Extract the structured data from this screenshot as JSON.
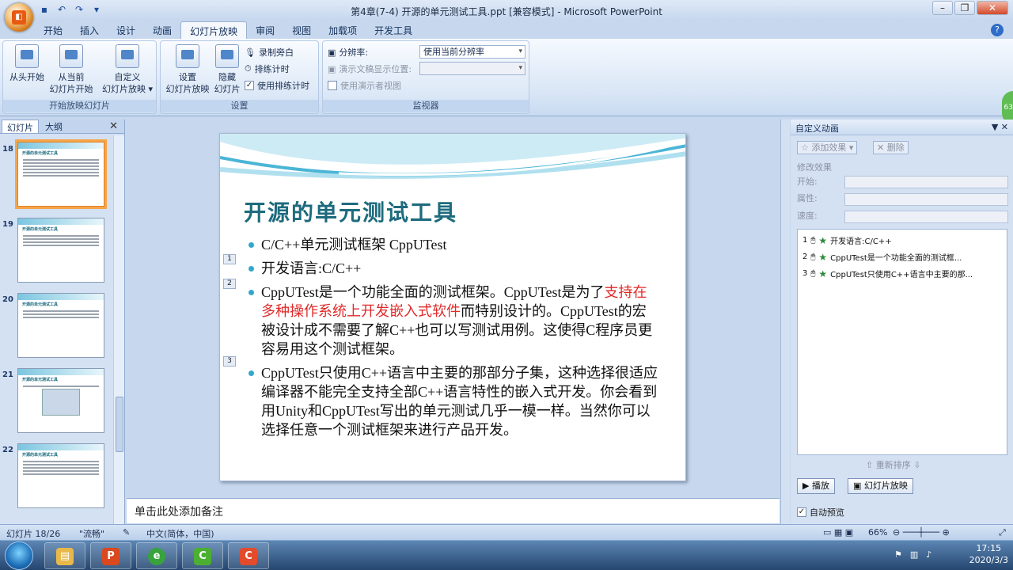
{
  "window": {
    "title": "第4章(7-4) 开源的单元测试工具.ppt [兼容模式] - Microsoft PowerPoint"
  },
  "ribbon_tabs": [
    "开始",
    "插入",
    "设计",
    "动画",
    "幻灯片放映",
    "审阅",
    "视图",
    "加载项",
    "开发工具"
  ],
  "ribbon": {
    "start_group": {
      "label": "开始放映幻灯片",
      "from_start": "从头开始",
      "from_current_1": "从当前",
      "from_current_2": "幻灯片开始",
      "custom_1": "自定义",
      "custom_2": "幻灯片放映"
    },
    "setup_group": {
      "label": "设置",
      "setup_1": "设置",
      "setup_2": "幻灯片放映",
      "hide_1": "隐藏",
      "hide_2": "幻灯片",
      "record": "录制旁白",
      "rehearse": "排练计时",
      "use_timing": "使用排练计时"
    },
    "monitor_group": {
      "label": "监视器",
      "resolution_label": "分辨率:",
      "resolution_value": "使用当前分辨率",
      "show_on_label": "演示文稿显示位置:",
      "presenter_view": "使用演示者视图"
    },
    "green_badge": "63"
  },
  "left_pane": {
    "tabs": [
      "幻灯片",
      "大纲"
    ],
    "slides": [
      {
        "num": "18",
        "title": "开源的单元测试工具"
      },
      {
        "num": "19",
        "title": "开源的单元测试工具"
      },
      {
        "num": "20",
        "title": "开源的单元测试工具"
      },
      {
        "num": "21",
        "title": "开源的单元测试工具"
      },
      {
        "num": "22",
        "title": "开源的单元测试工具"
      }
    ]
  },
  "slide": {
    "title": "开源的单元测试工具",
    "b1": "C/C++单元测试框架 CppUTest",
    "b2": "开发语言:C/C++",
    "b3_a": "CppUTest是一个功能全面的测试框架。CppUTest是为了",
    "b3_red": "支持在多种操作系统上开发嵌入式软件",
    "b3_b": "而特别设计的。CppUTest的宏被设计成不需要了解C++也可以写测试用例。这使得C程序员更容易用这个测试框架。",
    "b4": "CppUTest只使用C++语言中主要的那部分子集，这种选择很适应编译器不能完全支持全部C++语言特性的嵌入式开发。你会看到用Unity和CppUTest写出的单元测试几乎一模一样。当然你可以选择任意一个测试框架来进行产品开发。",
    "tags": [
      "1",
      "2",
      "3"
    ]
  },
  "notes": "单击此处添加备注",
  "custom_animation": {
    "title": "自定义动画",
    "add_effect": "添加效果",
    "remove": "删除",
    "modify": "修改效果",
    "start": "开始:",
    "property": "属性:",
    "speed": "速度:",
    "items": [
      {
        "n": "1",
        "text": "开发语言:C/C++"
      },
      {
        "n": "2",
        "text": "CppUTest是一个功能全面的测试框..."
      },
      {
        "n": "3",
        "text": "CppUTest只使用C++语言中主要的那..."
      }
    ],
    "reorder": "重新排序",
    "play": "播放",
    "slideshow": "幻灯片放映",
    "auto_preview": "自动预览"
  },
  "status": {
    "slide": "幻灯片 18/26",
    "theme": "\"流畅\"",
    "lang": "中文(简体，中国)",
    "zoom": "66%"
  },
  "clock": {
    "time": "17:15",
    "date": "2020/3/3"
  }
}
